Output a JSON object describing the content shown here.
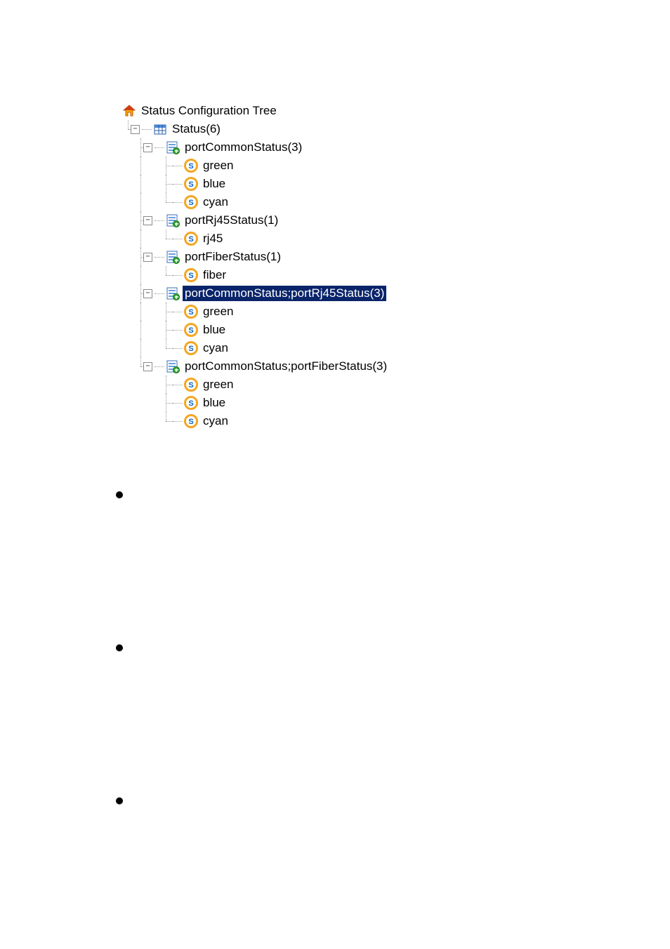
{
  "root": {
    "label": "Status Configuration Tree"
  },
  "status": {
    "label": "Status(6)"
  },
  "toggles": {
    "minus": "−"
  },
  "groups": [
    {
      "label": "portCommonStatus(3)",
      "selected": false,
      "children": [
        {
          "label": "green"
        },
        {
          "label": "blue"
        },
        {
          "label": "cyan"
        }
      ]
    },
    {
      "label": "portRj45Status(1)",
      "selected": false,
      "children": [
        {
          "label": "rj45"
        }
      ]
    },
    {
      "label": "portFiberStatus(1)",
      "selected": false,
      "children": [
        {
          "label": "fiber"
        }
      ]
    },
    {
      "label": "portCommonStatus;portRj45Status(3)",
      "selected": true,
      "children": [
        {
          "label": "green"
        },
        {
          "label": "blue"
        },
        {
          "label": "cyan"
        }
      ]
    },
    {
      "label": "portCommonStatus;portFiberStatus(3)",
      "selected": false,
      "children": [
        {
          "label": "green"
        },
        {
          "label": "blue"
        },
        {
          "label": "cyan"
        }
      ]
    }
  ]
}
